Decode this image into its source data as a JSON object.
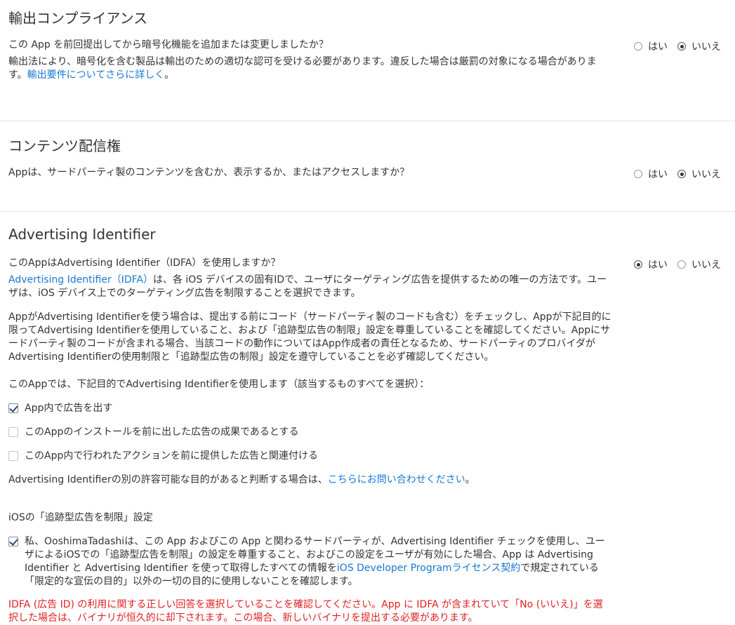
{
  "radio_labels": {
    "yes": "はい",
    "no": "いいえ"
  },
  "export_compliance": {
    "title": "輸出コンプライアンス",
    "question": "この App を前回提出してから暗号化機能を追加または変更しましたか？",
    "desc": "輸出法により、暗号化を含む製品は輸出のための適切な認可を受ける必要があります。違反した場合は厳罰の対象になる場合があります。",
    "link": "輸出要件についてさらに詳しく",
    "link_suffix": "。",
    "selected": "no"
  },
  "content_rights": {
    "title": "コンテンツ配信権",
    "question": "Appは、サードパーティ製のコンテンツを含むか、表示するか、またはアクセスしますか？",
    "selected": "no"
  },
  "advertising": {
    "title": "Advertising Identifier",
    "question": "このAppはAdvertising Identifier（IDFA）を使用しますか？",
    "selected": "yes",
    "idfa_link": "Advertising Identifier（IDFA）",
    "idfa_desc": "は、各 iOS デバイスの固有IDで、ユーザにターゲティング広告を提供するための唯一の方法です。ユーザは、iOS デバイス上でのターゲティング広告を制限することを選択できます。",
    "usage_paragraph": "AppがAdvertising Identifierを使う場合は、提出する前にコード（サードパーティ製のコードも含む）をチェックし、Appが下記目的に限ってAdvertising Identifierを使用していること、および「追跡型広告の制限」設定を尊重していることを確認してください。Appにサードパーティ製のコードが含まれる場合、当該コードの動作についてはApp作成者の責任となるため、サードパーティのプロバイダがAdvertising Identifierの使用制限と「追跡型広告の制限」設定を遵守していることを必ず確認してください。",
    "purposes_prompt": "このAppでは、下記目的でAdvertising Identifierを使用します（該当するものすべてを選択）：",
    "purposes": [
      {
        "label": "App内で広告を出す",
        "checked": true
      },
      {
        "label": "このAppのインストールを前に出した広告の成果であるとする",
        "checked": false
      },
      {
        "label": "このApp内で行われたアクションを前に提供した広告と関連付ける",
        "checked": false
      }
    ],
    "other_purpose_text": "Advertising Identifierの別の許容可能な目的があると判断する場合は、",
    "other_purpose_link": "こちらにお問い合わせください",
    "other_purpose_suffix": "。",
    "limit_tracking_title": "iOSの「追跡型広告を制限」設定",
    "attestation_before": "私、OoshimaTadashiは、この App およびこの App と関わるサードパーティが、Advertising Identifier チェックを使用し、ユーザによるiOSでの「追跡型広告を制限」の設定を尊重すること、およびこの設定をユーザが有効にした場合、App は Advertising Identifier と Advertising Identifier を使って取得したすべての情報を",
    "attestation_link": "iOS Developer Programライセンス契約",
    "attestation_after": "で規定されている「限定的な宣伝の目的」以外の一切の目的に使用しないことを確認します。",
    "attestation_checked": true,
    "error": "IDFA (広告 ID) の利用に関する正しい回答を選択していることを確認してください。App に IDFA が含まれていて「No (いいえ)」を選択した場合は、バイナリが恒久的に却下されます。この場合、新しいバイナリを提出する必要があります。"
  }
}
